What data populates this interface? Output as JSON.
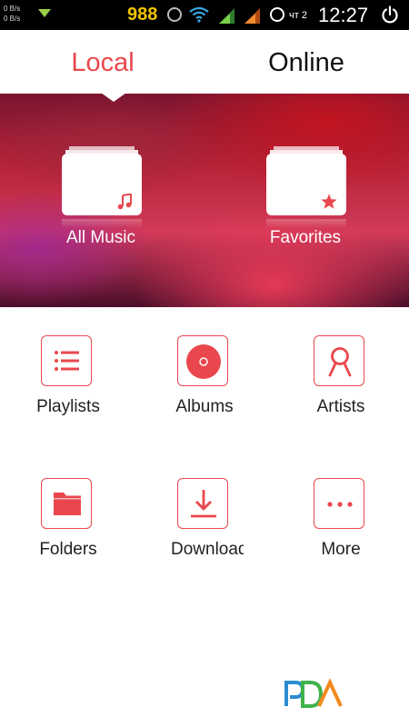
{
  "status_bar": {
    "net_up": "0 B/s",
    "net_down": "0 B/s",
    "number": "988",
    "day": "чт 2",
    "time": "12:27",
    "icons": [
      "download-arrow-icon",
      "alarm-icon",
      "wifi-icon",
      "signal-icon",
      "signal-icon",
      "sync-icon",
      "power-icon"
    ]
  },
  "tabs": [
    {
      "label": "Local",
      "selected": true
    },
    {
      "label": "Online",
      "selected": false
    }
  ],
  "banner": {
    "tiles": [
      {
        "label": "All Music",
        "icon": "music-note-icon"
      },
      {
        "label": "Favorites",
        "icon": "star-icon"
      }
    ]
  },
  "grid": [
    {
      "label": "Playlists",
      "icon": "list-icon"
    },
    {
      "label": "Albums",
      "icon": "disc-icon"
    },
    {
      "label": "Artists",
      "icon": "person-icon"
    },
    {
      "label": "Folders",
      "icon": "folder-icon"
    },
    {
      "label": "Downloads",
      "icon": "download-icon"
    },
    {
      "label": "More",
      "icon": "more-dots-icon"
    }
  ],
  "watermark": {
    "text": "PDA"
  },
  "colors": {
    "accent": "#e9474d",
    "status_number": "#f2c500"
  }
}
